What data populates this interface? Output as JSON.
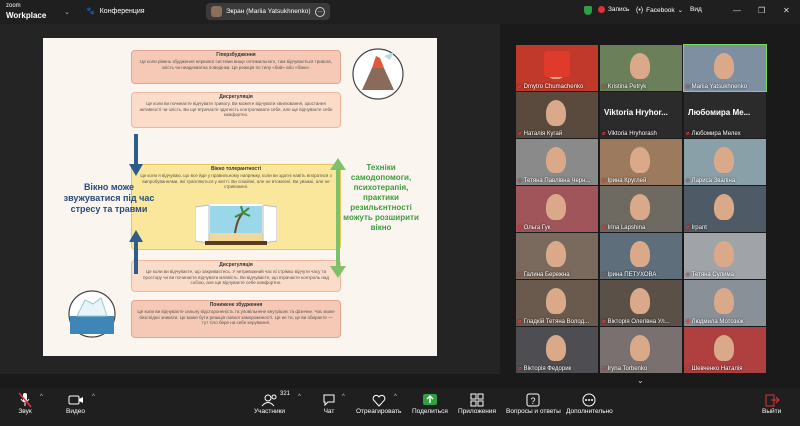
{
  "app": {
    "logo_line1": "zoom",
    "logo_line2": "Workplace"
  },
  "topbar": {
    "conference_label": "Конференция",
    "screen_share_label": "Экран (Mariia Yatsukhnenko)",
    "record_label": "Запись",
    "facebook_label": "Facebook",
    "view_label": "Вид"
  },
  "slide": {
    "hyper_title": "Гіперзбудження",
    "hyper_text": "Це коли рівень збудження нервової системи вище оптимального, там відчувається тривога, злість чи неадекватна поведінка. Це реакція по типу «бий» або «біжи».",
    "dysreg1_title": "Дисрегуляція",
    "dysreg1_text": "Це коли ви починаєте відчувати тривогу. Ви можете відчувати хвилювання, зростання активності чи злість. Ви ще втрачаєте здатність контролювати себе, але ще відчуваєте себе комфортно.",
    "window_title": "Вікно толерантності",
    "window_text": "Це коли я відчуваю, що все йде у правильному напрямку, коли ви здатні навіть впоратися з випробуваннями, які трапляються у житті. Ви спокійні, але не втомлені. Ви уважні, але не стривожені.",
    "dysreg2_title": "Дисрегуляція",
    "dysreg2_text": "Це коли ви відчуваєте, що закриваєтесь. У нетривожний час ві стрімко відчути часу та простору чи ви починаєте відчувати млявість. Ви відчуваєте, що втрачаєте контроль над собою, але ще відчуваєте себе комфортно.",
    "hypo_title": "Понижене збудження",
    "hypo_text": "Це коли ви відчуваєте сильну відстороненість та уповільнене внутрішнє та фізичне. Час може безслідно зникати. Це може бути реакція повної заморожиності. Це не ти, це ви обираєте — тут тіло бере на себе керування.",
    "left_caption": "Вікно може звужуватися під час стресу та травми",
    "right_caption": "Техніки самодопомоги, психотерапія, практики резильєнтності можуть розширити вікно"
  },
  "gallery": {
    "tiles": [
      {
        "name": "Dmytro Chumachenko",
        "big": ""
      },
      {
        "name": "Kristina Petryk",
        "big": ""
      },
      {
        "name": "Mariia Yatsukhnenko",
        "big": ""
      },
      {
        "name": "Наталія Кугай",
        "big": ""
      },
      {
        "name": "Viktoria Hryhorash",
        "big": "Viktoria Hryhor..."
      },
      {
        "name": "Любомира Мелех",
        "big": "Любомира Ме..."
      },
      {
        "name": "Тетяна Павлівна Черн...",
        "big": ""
      },
      {
        "name": "Ірина Круглей",
        "big": ""
      },
      {
        "name": "Лариса Зваліна",
        "big": ""
      },
      {
        "name": "Ольга Гук",
        "big": ""
      },
      {
        "name": "Irina Lapshina",
        "big": ""
      },
      {
        "name": "Irpant",
        "big": ""
      },
      {
        "name": "Галина Бережна",
        "big": ""
      },
      {
        "name": "Ірина ПЕТУХОВА",
        "big": ""
      },
      {
        "name": "Тетяна Сулима",
        "big": ""
      },
      {
        "name": "Гладкій Тетяна Волод...",
        "big": ""
      },
      {
        "name": "Вікторія Олегівна Ул...",
        "big": ""
      },
      {
        "name": "Людмила Мотозюк",
        "big": ""
      },
      {
        "name": "Вікторія Федорик",
        "big": ""
      },
      {
        "name": "Iryna Torbenko",
        "big": ""
      },
      {
        "name": "Шевченко Наталія",
        "big": ""
      }
    ]
  },
  "toolbar": {
    "audio": "Звук",
    "video": "Видео",
    "participants": "Участники",
    "participants_count": "321",
    "chat": "Чат",
    "react": "Отреагировать",
    "share": "Поделиться",
    "apps": "Приложения",
    "qa": "Вопросы и ответы",
    "more": "Дополнительно",
    "leave": "Выйти"
  }
}
